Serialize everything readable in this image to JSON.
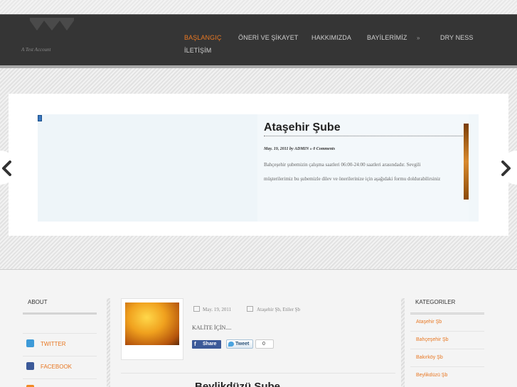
{
  "header": {
    "tagline": "A Test Account",
    "nav": [
      {
        "label": "BAŞLANGIÇ",
        "active": true
      },
      {
        "label": "ÖNERİ VE ŞİKAYET",
        "active": false
      },
      {
        "label": "HAKKIMIZDA",
        "active": false
      },
      {
        "label": "BAYİLERİMİZ",
        "active": false
      },
      {
        "label": "»",
        "active": false
      },
      {
        "label": "DRY NESS",
        "active": false
      },
      {
        "label": "İLETİŞİM",
        "active": false
      }
    ],
    "accent_color": "#e87722"
  },
  "slider": {
    "title": "Ataşehir Şube",
    "meta": "May. 19, 2011 by ADMIN » 0 Comments",
    "excerpt_line1": "Bahçeşehir  şubemizin çalışma saatleri 06:00-24:00 saatleri arasındadır. Sevgili",
    "excerpt_line2": "müşterilerimiz bu şubemizle dilev ve önerilerinize için aşağıdaki formu doldurabilirsiniz",
    "prev_icon": "chevron-left-icon",
    "next_icon": "chevron-right-icon"
  },
  "about": {
    "title": "ABOUT",
    "links": [
      {
        "label": "TWITTER",
        "icon": "twitter-icon",
        "color": "#3d9ad8"
      },
      {
        "label": "FACEBOOK",
        "icon": "facebook-icon",
        "color": "#3b5998"
      }
    ]
  },
  "post": {
    "date": "May. 19, 2011",
    "categories": "Ataşehir Şb, Etiler Şb",
    "excerpt": "KALİTE İÇİN....",
    "share_label": "Share",
    "tweet_label": "Tweet",
    "count": "0",
    "next_title": "Beylikdüzü Şube"
  },
  "categories": {
    "title": "KATEGORILER",
    "items": [
      "Ataşehir Şb",
      "Bahçeşehir Şb",
      "Bakırköy Şb",
      "Beylikdüzü Şb"
    ]
  }
}
